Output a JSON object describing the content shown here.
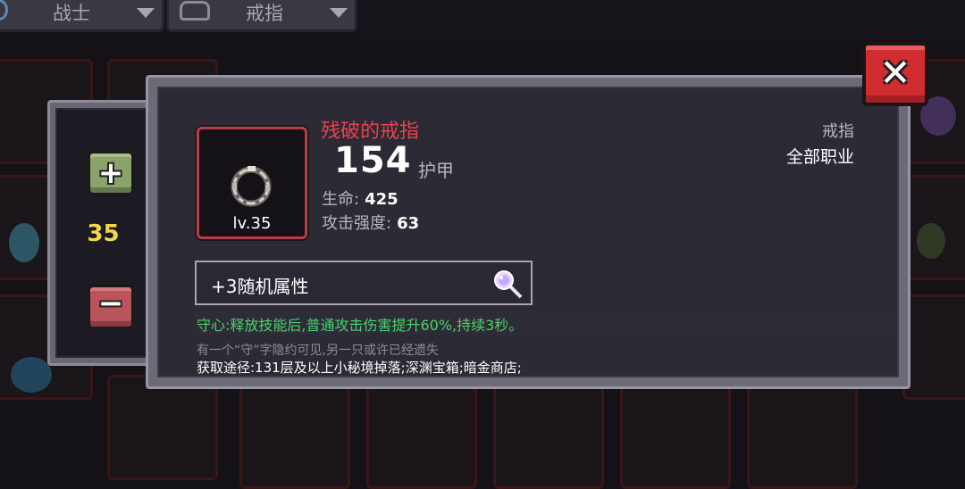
{
  "filters": {
    "class_label": "战士",
    "slot_label": "戒指"
  },
  "level_selector": {
    "plus_label": "+",
    "minus_label": "−",
    "value": "35"
  },
  "item": {
    "name": "残破的戒指",
    "level_label": "lv.35",
    "armor_value": "154",
    "armor_label": "护甲",
    "stats": [
      {
        "label": "生命:",
        "value": "425"
      },
      {
        "label": "攻击强度:",
        "value": "63"
      }
    ],
    "slot_type": "戒指",
    "class_requirement": "全部职业",
    "random_attributes": "+3随机属性",
    "effect": "守心:释放技能后,普通攻击伤害提升60%,持续3秒。",
    "flavor": "有一个“守”字隐约可见,另一只或许已经遗失",
    "source": "获取途径:131层及以上小秘境掉落;深渊宝箱;暗金商店;",
    "name_color": "#e8424e",
    "effect_color": "#4ad26a"
  },
  "close_button": {
    "label": "✕"
  }
}
